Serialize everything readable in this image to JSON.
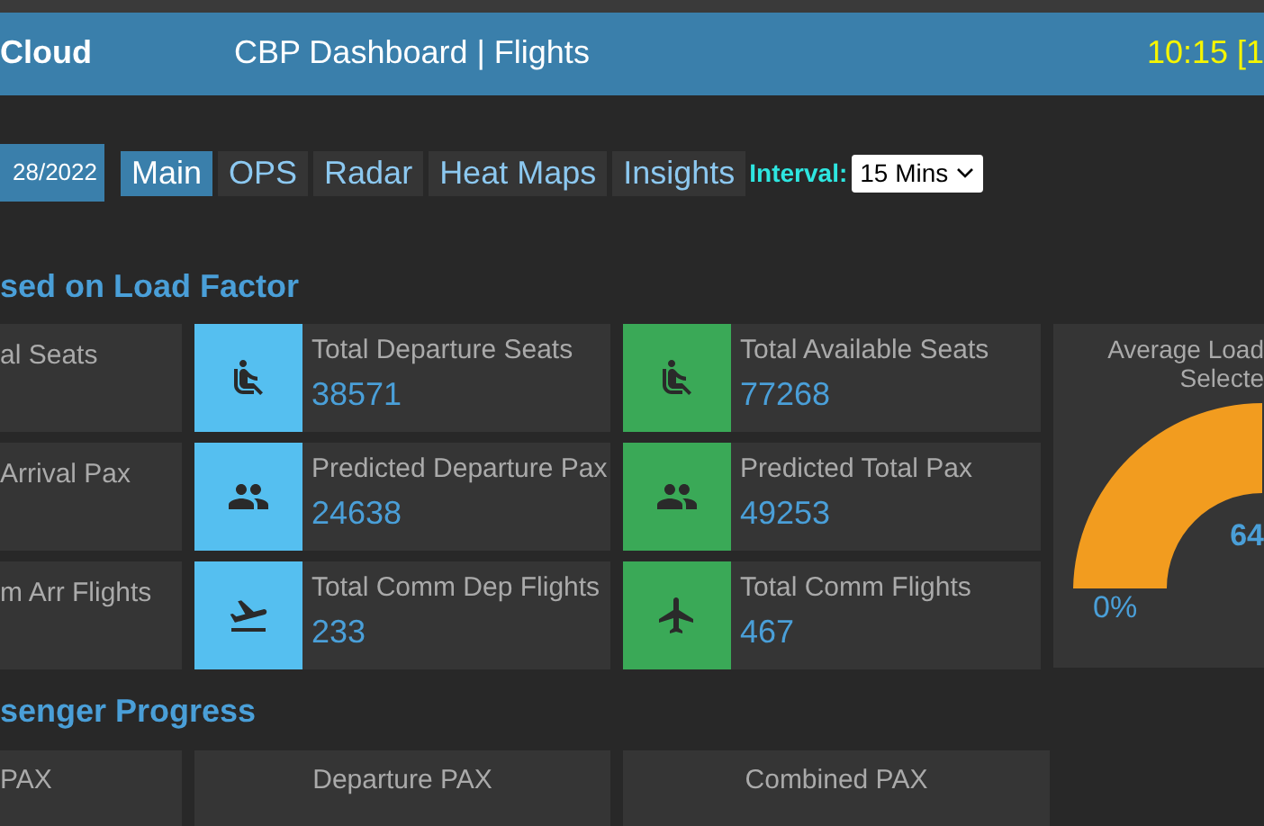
{
  "header": {
    "brand": "Cloud",
    "title": "CBP Dashboard | Flights",
    "time": "10:15 [1"
  },
  "toolbar": {
    "date": "28/2022",
    "tabs": [
      {
        "label": "Main",
        "selected": true
      },
      {
        "label": "OPS",
        "selected": false
      },
      {
        "label": "Radar",
        "selected": false
      },
      {
        "label": "Heat Maps",
        "selected": false
      },
      {
        "label": "Insights",
        "selected": false
      }
    ],
    "interval_label": "Interval:",
    "interval_value": "15 Mins"
  },
  "load_factor": {
    "heading": "sed on Load Factor",
    "rows": [
      {
        "left_label": "al Seats",
        "cards": [
          {
            "kind": "seat",
            "color": "#55bff0",
            "label": "Total Departure Seats",
            "value": "38571"
          },
          {
            "kind": "seat",
            "color": "#3aa957",
            "label": "Total Available Seats",
            "value": "77268"
          }
        ]
      },
      {
        "left_label": "Arrival Pax",
        "cards": [
          {
            "kind": "people",
            "color": "#55bff0",
            "label": "Predicted Departure Pax",
            "value": "24638"
          },
          {
            "kind": "people",
            "color": "#3aa957",
            "label": "Predicted Total Pax",
            "value": "49253"
          }
        ]
      },
      {
        "left_label": "m Arr Flights",
        "cards": [
          {
            "kind": "takeoff",
            "color": "#55bff0",
            "label": "Total Comm Dep Flights",
            "value": "233"
          },
          {
            "kind": "plane",
            "color": "#3aa957",
            "label": "Total Comm Flights",
            "value": "467"
          }
        ]
      }
    ],
    "gauge": {
      "title_lines": [
        "Average Load",
        "Selecte"
      ],
      "min_label": "0%",
      "value": "64"
    }
  },
  "passenger_progress": {
    "heading": "senger Progress",
    "panels": [
      "PAX",
      "Departure PAX",
      "Combined PAX"
    ]
  }
}
